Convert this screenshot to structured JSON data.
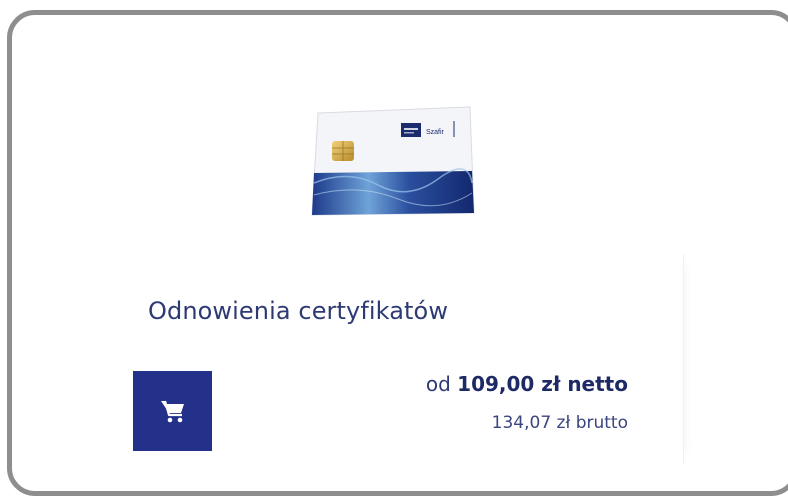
{
  "product": {
    "title": "Odnowienia certyfikatów",
    "card_logo_text": "Szafir",
    "cart_icon": "shopping-cart-icon",
    "price": {
      "prefix": "od",
      "net_amount": "109,00 zł netto",
      "gross": "134,07 zł brutto"
    }
  },
  "colors": {
    "accent": "#23318a",
    "title_text": "#2e3a74",
    "frame_border": "#8e8e8e"
  }
}
